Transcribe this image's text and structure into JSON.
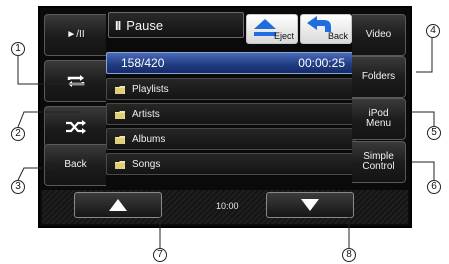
{
  "top_bar": {
    "status": "Pause",
    "eject_label": "Eject",
    "back_label": "Back"
  },
  "track": {
    "index": "158/420",
    "time": "00:00:25"
  },
  "list": [
    {
      "label": "Playlists"
    },
    {
      "label": "Artists"
    },
    {
      "label": "Albums"
    },
    {
      "label": "Songs"
    }
  ],
  "left_buttons": {
    "back": "Back"
  },
  "right_buttons": {
    "video": "Video",
    "folders": "Folders",
    "ipod_menu_line1": "iPod",
    "ipod_menu_line2": "Menu",
    "simple_control_line1": "Simple",
    "simple_control_line2": "Control"
  },
  "bottom": {
    "clock": "10:00"
  },
  "callouts": [
    "1",
    "2",
    "3",
    "4",
    "5",
    "6",
    "7",
    "8"
  ],
  "colors": {
    "screen_bg": "#0a0a0a",
    "highlight_blue": "#2a4a9a",
    "icon_blue": "#1f6ee0",
    "folder_yellow": "#f3e6a8"
  }
}
